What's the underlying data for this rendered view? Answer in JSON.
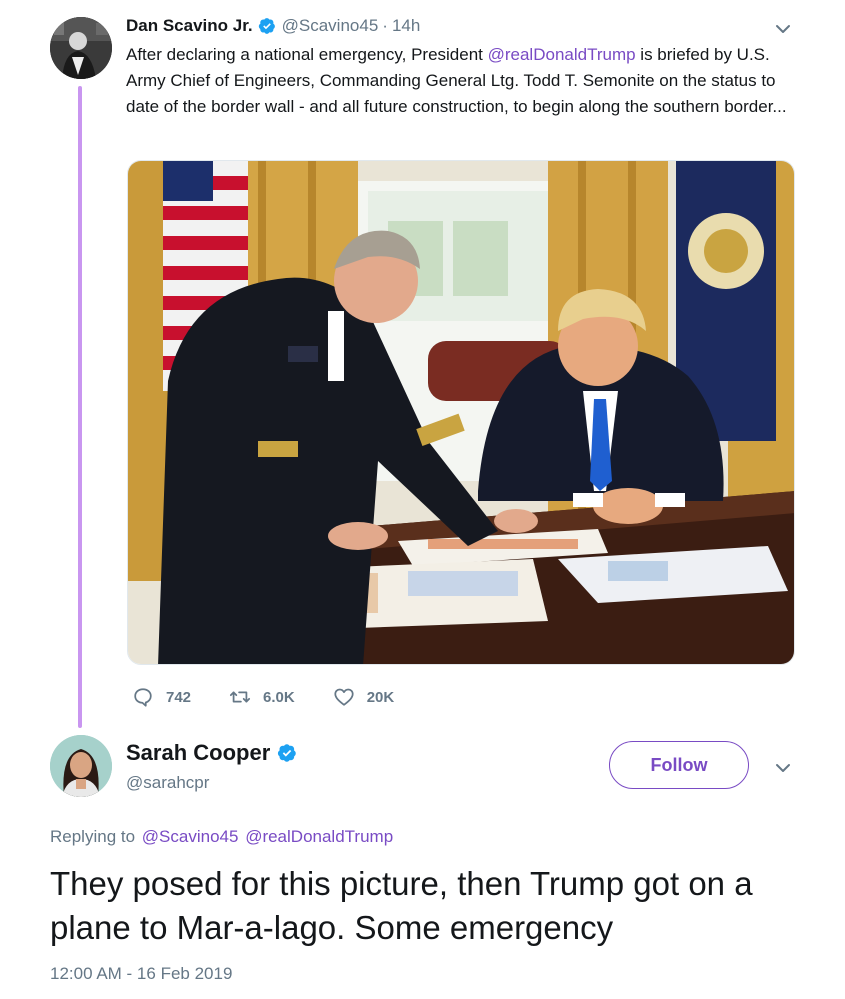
{
  "colors": {
    "accent": "#794bc4",
    "thread_line": "#c996f0",
    "muted": "#657786",
    "verified": "#1da1f2"
  },
  "tweet": {
    "author_name": "Dan Scavino Jr.",
    "handle": "@Scavino45",
    "separator": "·",
    "time": "14h",
    "text_before": "After declaring a national emergency, President ",
    "mention": "@realDonaldTrump",
    "text_after": " is briefed by U.S. Army Chief of Engineers, Commanding General Ltg. Todd T. Semonite on the status to date of the border wall - and all future construction, to begin along the southern border...",
    "photo_icon": "photo-oval-office-briefing",
    "stats": {
      "replies": "742",
      "retweets": "6.0K",
      "likes": "20K"
    }
  },
  "reply": {
    "author_name": "Sarah Cooper",
    "handle": "@sarahcpr",
    "follow_label": "Follow",
    "replying_to_label": "Replying to",
    "replying_to": [
      "@Scavino45",
      "@realDonaldTrump"
    ],
    "text": "They posed for this picture, then Trump got on a plane to Mar-a-lago. Some emergency",
    "timestamp": "12:00 AM - 16 Feb 2019"
  }
}
